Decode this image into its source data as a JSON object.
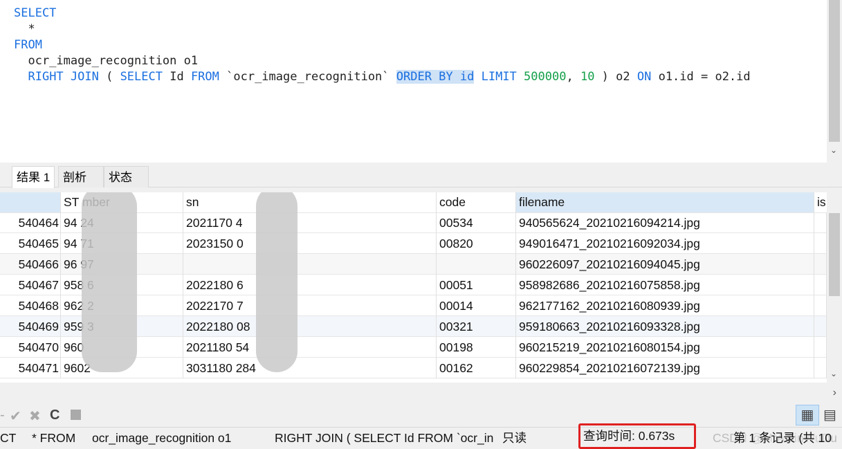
{
  "editor": {
    "lines": [
      {
        "kw1": "SELECT"
      },
      {
        "text": "  *"
      },
      {
        "kw1": "FROM"
      },
      {
        "text": "  ocr_image_recognition o1"
      },
      {
        "kw1": "RIGHT JOIN",
        "p1": " ( ",
        "kw2": "SELECT",
        "p2": " Id ",
        "kw3": "FROM",
        "p3": " `ocr_image_recognition` ",
        "sel": "ORDER BY id",
        "p4": " ",
        "kw4": "LIMIT",
        "p5": " ",
        "n1": "500000",
        "p6": ", ",
        "n2": "10",
        "p7": " ) o2 ",
        "kw5": "ON",
        "p8": " o1.id = o2.id"
      }
    ]
  },
  "tabs": [
    {
      "label": "结果 1"
    },
    {
      "label": "剖析"
    },
    {
      "label": "状态"
    }
  ],
  "grid": {
    "columns": [
      "",
      "ST      mber",
      "sn",
      "code",
      "filename",
      "is"
    ],
    "rows": [
      [
        "540464",
        "94      24",
        "2021170        4",
        "00534",
        "940565624_20210216094214.jpg"
      ],
      [
        "540465",
        "94      71",
        "2023150        0",
        "00820",
        "949016471_20210216092034.jpg"
      ],
      [
        "540466",
        "96      97",
        "",
        "",
        "960226097_20210216094045.jpg"
      ],
      [
        "540467",
        "958     6",
        "2022180        6",
        "00051",
        "958982686_20210216075858.jpg"
      ],
      [
        "540468",
        "962     2",
        "2022170        7",
        "00014",
        "962177162_20210216080939.jpg"
      ],
      [
        "540469",
        "959     3",
        "2022180       08",
        "00321",
        "959180663_20210216093328.jpg"
      ],
      [
        "540470",
        "960",
        "2021180       54",
        "00198",
        "960215219_20210216080154.jpg"
      ],
      [
        "540471",
        "9602",
        "3031180       284",
        "00162",
        "960229854_20210216072139.jpg"
      ]
    ]
  },
  "status": {
    "sql1": "CT",
    "sql2": "* FROM",
    "sql3": "ocr_image_recognition o1",
    "sql4": "RIGHT JOIN ( SELECT Id FROM `ocr_in",
    "mode": "只读",
    "query_time": "查询时间: 0.673s",
    "records": "第 1 条记录 (共 10",
    "watermark": "CSDN @MrAnlinWuDu"
  },
  "colors": {
    "keyword": "#1a6fe0",
    "number": "#14a04a",
    "highlight": "#e02020"
  }
}
